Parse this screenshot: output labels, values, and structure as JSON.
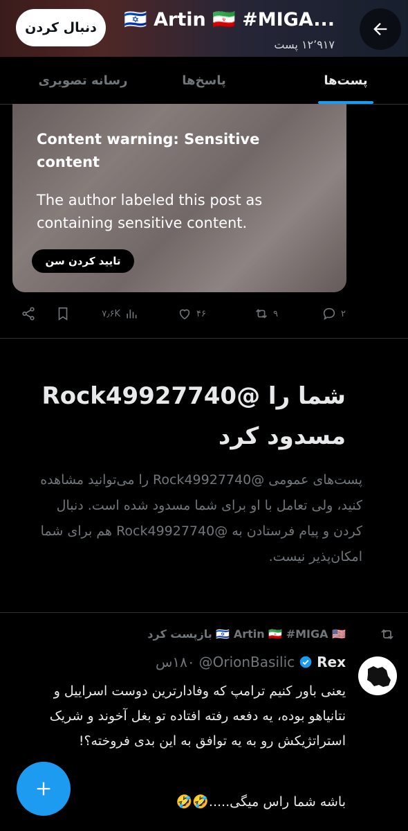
{
  "header": {
    "title": "Artin 🇮🇷 #MIGA...",
    "title_flag_left": "🇮🇱",
    "subtitle": "۱۲٬۹۱۷ پست",
    "follow_label": "دنبال کردن"
  },
  "tabs": [
    {
      "label": "پست‌ها",
      "active": true
    },
    {
      "label": "پاسخ‌ها",
      "active": false
    },
    {
      "label": "رسانه تصویری",
      "active": false
    }
  ],
  "sensitive_post": {
    "warning_title": "Content warning: Sensitive content",
    "warning_body": "The author labeled this post as containing sensitive content.",
    "age_button": "تایید کردن سن",
    "replies": "۲",
    "reposts": "۹",
    "likes": "۴۶",
    "views": "۷٫۶K"
  },
  "blocked": {
    "title": "شما را @Rock49927740 مسدود کرد",
    "body": "پست‌های عمومی @Rock49927740 را می‌توانید مشاهده کنید، ولی تعامل با او برای شما مسدود شده است. دنبال کردن و پیام فرستادن به @Rock49927740 هم برای شما امکان‌پذیر نیست."
  },
  "repost": {
    "label": "🇮🇱 Artin 🇮🇷 #MIGA 🇺🇸 بازپست کرد",
    "author_name": "Rex",
    "handle": "@OrionBasilic",
    "time": "۱۸۰س",
    "text": "یعنی باور کنیم ترامپ که وفادارترین دوست اسراییل و نتانیاهو بوده، یه دفعه رفته افتاده تو بغل آخوند و شریک استراتژیکش رو به یه توافق به این بدی فروخته؟!",
    "text2": "باشه شما راس میگی.....🤣🤣"
  },
  "colors": {
    "accent": "#1d9bf0",
    "background": "#000000",
    "muted": "#71767b"
  },
  "icons": [
    "back-arrow-icon",
    "reply-icon",
    "repost-icon",
    "like-icon",
    "views-icon",
    "bookmark-icon",
    "share-icon",
    "verified-icon",
    "compose-plus-icon"
  ]
}
